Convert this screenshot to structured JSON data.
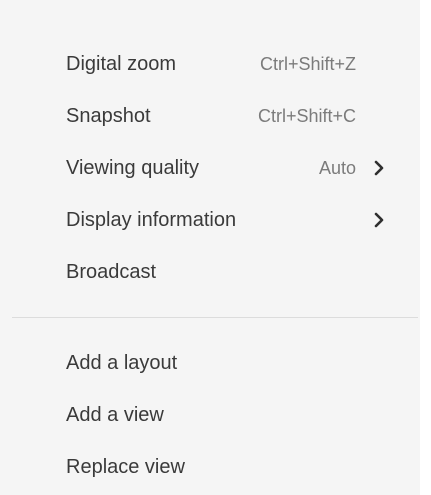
{
  "menu": {
    "group1": [
      {
        "label": "Digital zoom",
        "shortcut": "Ctrl+Shift+Z"
      },
      {
        "label": "Snapshot",
        "shortcut": "Ctrl+Shift+C"
      },
      {
        "label": "Viewing quality",
        "value": "Auto",
        "icon": "chevron-right-icon"
      },
      {
        "label": "Display information",
        "icon": "chevron-right-icon"
      },
      {
        "label": "Broadcast"
      }
    ],
    "group2": [
      {
        "label": "Add a layout"
      },
      {
        "label": "Add a view"
      },
      {
        "label": "Replace view"
      }
    ]
  },
  "colors": {
    "background": "#f5f5f5",
    "text": "#3a3a3a",
    "secondary_text": "#7b7b7b",
    "divider": "#dcdcdc"
  }
}
